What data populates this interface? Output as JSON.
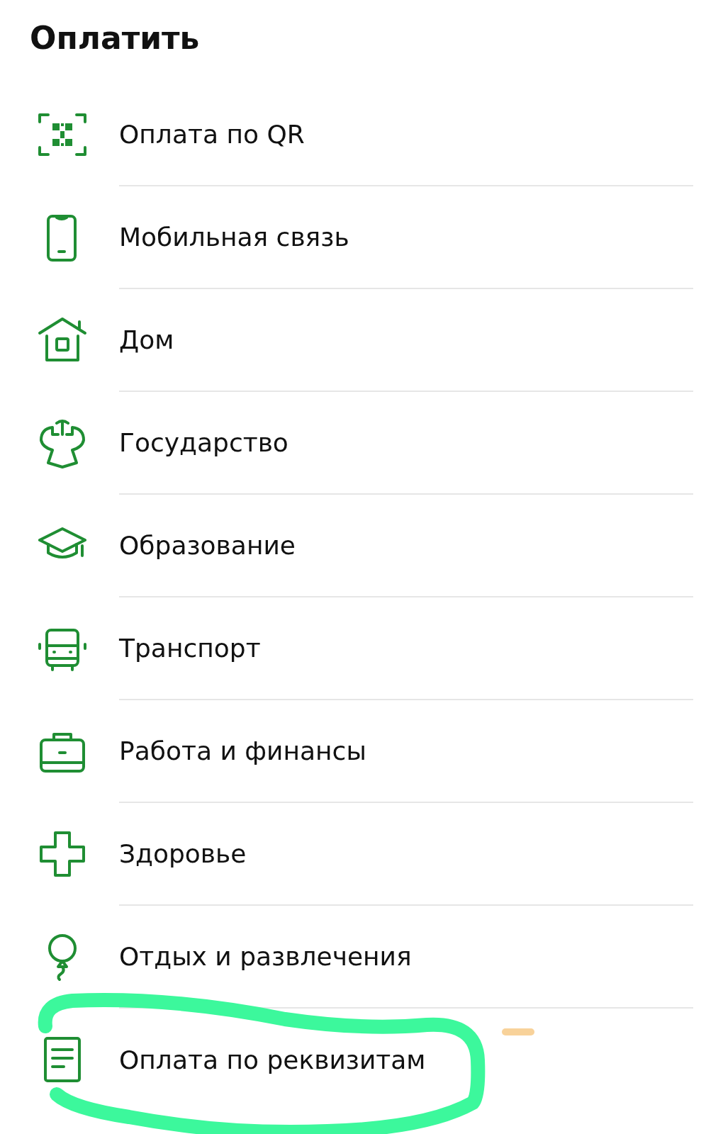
{
  "title": "Оплатить",
  "items": [
    {
      "label": "Оплата по QR"
    },
    {
      "label": "Мобильная связь"
    },
    {
      "label": "Дом"
    },
    {
      "label": "Государство"
    },
    {
      "label": "Образование"
    },
    {
      "label": "Транспорт"
    },
    {
      "label": "Работа и финансы"
    },
    {
      "label": "Здоровье"
    },
    {
      "label": "Отдых и развлечения"
    },
    {
      "label": "Оплата по реквизитам"
    }
  ]
}
